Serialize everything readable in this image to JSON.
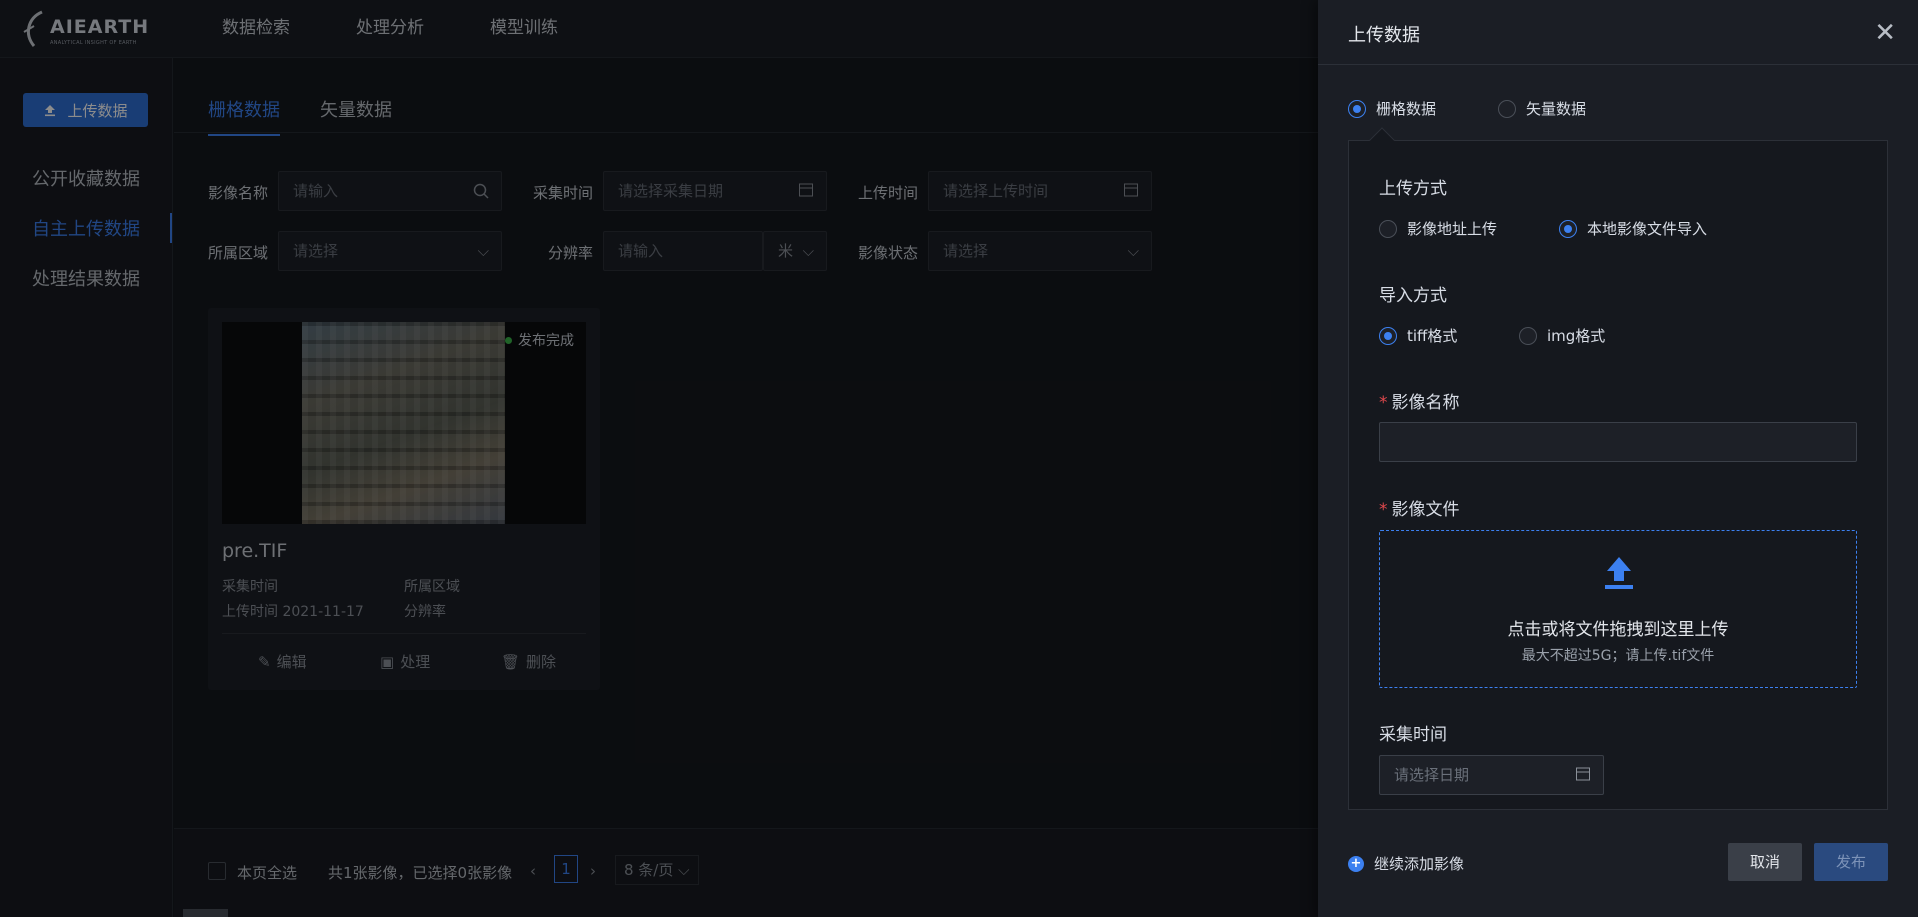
{
  "app": {
    "logo_text": "AIEARTH",
    "logo_sub": "ANALYTICAL INSIGHT OF EARTH"
  },
  "nav": {
    "items": [
      {
        "label": "数据检索"
      },
      {
        "label": "处理分析"
      },
      {
        "label": "模型训练"
      }
    ]
  },
  "sidebar": {
    "upload_label": "上传数据",
    "items": [
      {
        "label": "公开收藏数据"
      },
      {
        "label": "自主上传数据"
      },
      {
        "label": "处理结果数据"
      }
    ]
  },
  "tabs": [
    {
      "label": "栅格数据"
    },
    {
      "label": "矢量数据"
    }
  ],
  "filters": {
    "image_name_label": "影像名称",
    "image_name_placeholder": "请输入",
    "collect_time_label": "采集时间",
    "collect_time_placeholder": "请选择采集日期",
    "upload_time_label": "上传时间",
    "upload_time_placeholder": "请选择上传时间",
    "region_label": "所属区域",
    "region_placeholder": "请选择",
    "resolution_label": "分辨率",
    "resolution_placeholder": "请输入",
    "resolution_unit": "米",
    "status_label": "影像状态",
    "status_placeholder": "请选择"
  },
  "card": {
    "status": "发布完成",
    "name": "pre.TIF",
    "collect_time_label": "采集时间",
    "region_label": "所属区域",
    "upload_time_label": "上传时间",
    "upload_time_value": "2021-11-17",
    "resolution_label": "分辨率",
    "actions": [
      {
        "label": "编辑"
      },
      {
        "label": "处理"
      },
      {
        "label": "删除"
      }
    ]
  },
  "footer": {
    "select_all": "本页全选",
    "summary": "共1张影像，已选择0张影像",
    "page": "1",
    "page_size": "8 条/页"
  },
  "drawer": {
    "title": "上传数据",
    "type_options": [
      {
        "label": "栅格数据",
        "selected": true
      },
      {
        "label": "矢量数据",
        "selected": false
      }
    ],
    "upload_method_title": "上传方式",
    "upload_methods": [
      {
        "label": "影像地址上传",
        "selected": false
      },
      {
        "label": "本地影像文件导入",
        "selected": true
      }
    ],
    "import_method_title": "导入方式",
    "import_methods": [
      {
        "label": "tiff格式",
        "selected": true
      },
      {
        "label": "img格式",
        "selected": false
      }
    ],
    "image_name_title": "影像名称",
    "image_file_title": "影像文件",
    "dropzone_main": "点击或将文件拖拽到这里上传",
    "dropzone_sub": "最大不超过5G；请上传.tif文件",
    "collect_time_title": "采集时间",
    "date_placeholder": "请选择日期",
    "add_more": "继续添加影像",
    "cancel": "取消",
    "publish": "发布"
  },
  "colors": {
    "accent": "#3c80f0",
    "required": "#e0484d",
    "status_ok": "#3bb54a"
  }
}
